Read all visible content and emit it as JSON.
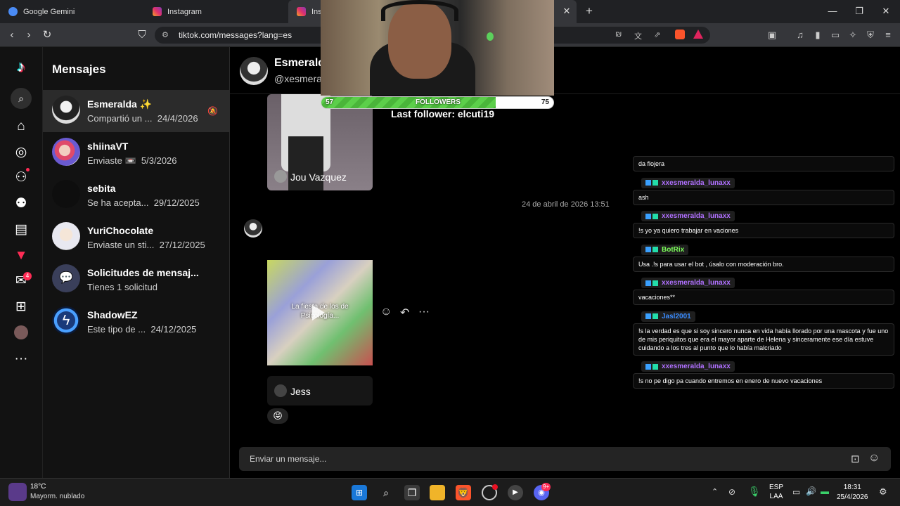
{
  "browser": {
    "tabs": [
      {
        "label": "Google Gemini",
        "icon": "gemini-icon",
        "color": "#4a8bf5"
      },
      {
        "label": "Instagram",
        "icon": "instagram-icon",
        "color": "#e1306c"
      },
      {
        "label": "Ins",
        "icon": "instagram-icon",
        "color": "#e1306c"
      }
    ],
    "url": "tiktok.com/messages?lang=es"
  },
  "sidebar": {
    "inbox_badge": "4"
  },
  "conversations": {
    "title": "Mensajes",
    "items": [
      {
        "name": "Esmeralda ✨",
        "preview": "Compartió un ...",
        "date": "24/4/2026",
        "muted": true
      },
      {
        "name": "shiinaVT",
        "preview": "Enviaste 📼",
        "date": "5/3/2026"
      },
      {
        "name": "sebita",
        "preview": "Se ha acepta...",
        "date": "29/12/2025"
      },
      {
        "name": "YuriChocolate",
        "preview": "Enviaste un sti...",
        "date": "27/12/2025"
      },
      {
        "name": "Solicitudes de mensaj...",
        "preview": "Tienes 1 solicitud",
        "date": ""
      },
      {
        "name": "ShadowEZ",
        "preview": "Este tipo de ...",
        "date": "24/12/2025"
      }
    ]
  },
  "chat": {
    "name": "Esmerald",
    "username": "@xesmera",
    "card1_author": "Jou Vazquez",
    "timestamp": "24 de abril de 2026 13:51",
    "card2_caption": "La fiesta de los de Psicología...",
    "card2_author": "Jess",
    "reaction": "😝",
    "input_placeholder": "Enviar un mensaje..."
  },
  "overlay": {
    "followers_label": "FOLLOWERS",
    "followers_min": "57",
    "followers_max": "75",
    "followers_progress": 0.75,
    "last_follower": "Last follower: elcuti19",
    "chat": [
      {
        "user": "",
        "text": "da flojera"
      },
      {
        "user": "xxesmeralda_lunaxx",
        "color": "#b070ff",
        "text": "ash"
      },
      {
        "user": "xxesmeralda_lunaxx",
        "color": "#b070ff",
        "text": "!s yo ya quiero trabajar en vaciones"
      },
      {
        "user": "BotRix",
        "color": "#7cff5a",
        "text": "Usa .!s para usar el bot , úsalo con moderación bro."
      },
      {
        "user": "xxesmeralda_lunaxx",
        "color": "#b070ff",
        "text": "vacaciones**"
      },
      {
        "user": "Jasl2001",
        "color": "#3a8cff",
        "text": "!s la verdad es que si soy sincero nunca en vida había llorado por una mascota y fue uno de mis periquitos que era el mayor aparte de Helena y sinceramente ese día estuve cuidando a los tres al punto que lo había malcriado"
      },
      {
        "user": "xxesmeralda_lunaxx",
        "color": "#b070ff",
        "text": "!s no pe digo pa cuando entremos en enero de nuevo vacaciones"
      }
    ]
  },
  "taskbar": {
    "weather_temp": "18°C",
    "weather_desc": "Mayorm. nublado",
    "lang1": "ESP",
    "lang2": "LAA",
    "time": "18:31",
    "date": "25/4/2026",
    "discord_badge": "9+"
  }
}
